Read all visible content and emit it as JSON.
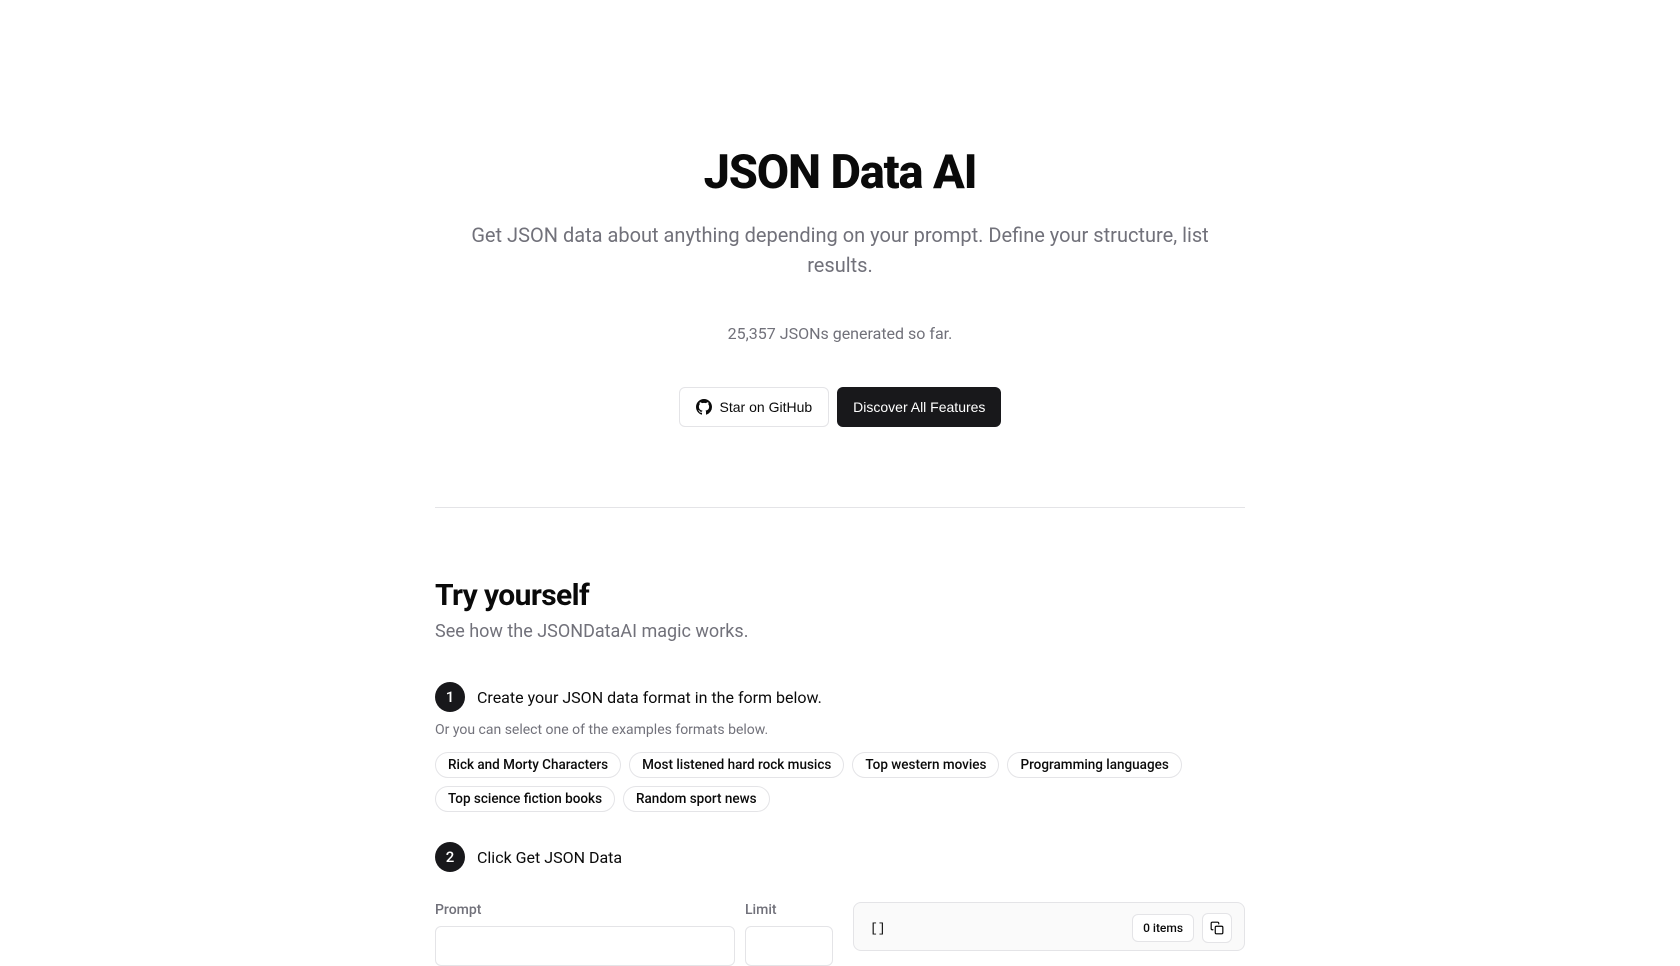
{
  "hero": {
    "title": "JSON Data AI",
    "subtitle": "Get JSON data about anything depending on your prompt. Define your structure, list results.",
    "stat": "25,357 JSONs generated so far.",
    "star_button": "Star on GitHub",
    "discover_button": "Discover All Features"
  },
  "try": {
    "title": "Try yourself",
    "subtitle": "See how the JSONDataAI magic works.",
    "step1_number": "1",
    "step1_text": "Create your JSON data format in the form below.",
    "step1_sub": "Or you can select one of the examples formats below.",
    "examples": [
      "Rick and Morty Characters",
      "Most listened hard rock musics",
      "Top western movies",
      "Programming languages",
      "Top science fiction books",
      "Random sport news"
    ],
    "step2_number": "2",
    "step2_text": "Click Get JSON Data"
  },
  "form": {
    "prompt_label": "Prompt",
    "limit_label": "Limit"
  },
  "output": {
    "code": "[]",
    "items_badge": "0 items"
  }
}
